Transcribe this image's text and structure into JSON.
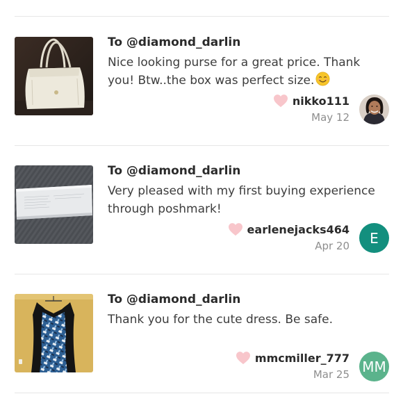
{
  "colors": {
    "heart": "#f8c6cb",
    "avatar_teal": "#138f7e",
    "avatar_green": "#5bb38c",
    "divider": "#e6e6e6"
  },
  "reviews": [
    {
      "to": "To @diamond_darlin",
      "message": "Nice looking purse for a great price. Thank you! Btw..the box was perfect size.",
      "emoji": "smiling-face-emoji",
      "username": "nikko111",
      "date": "May 12",
      "avatar": {
        "type": "photo"
      }
    },
    {
      "to": "To @diamond_darlin",
      "message": "Very pleased with my first buying experience through poshmark!",
      "username": "earlenejacks464",
      "date": "Apr 20",
      "avatar": {
        "type": "letter",
        "text": "E"
      }
    },
    {
      "to": "To @diamond_darlin",
      "message": "Thank you for the cute dress. Be safe.",
      "username": "mmcmiller_777",
      "date": "Mar 25",
      "avatar": {
        "type": "letter",
        "text": "MM"
      }
    }
  ]
}
